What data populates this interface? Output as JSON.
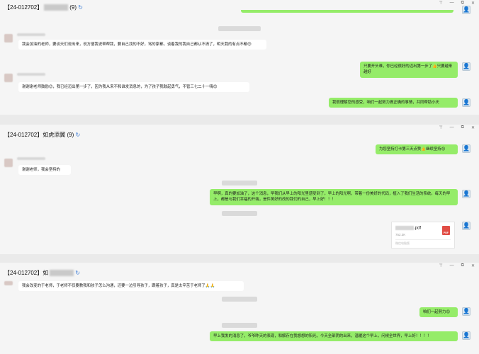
{
  "panels": [
    {
      "title_prefix": "【24-012702】",
      "title_count": "(9)",
      "messages": [
        {
          "id": "m1",
          "side": "left",
          "text": "我会加油的老师，要谈天们说出来，说方便我说帮帮我，要自己找的不好，骂的家都，谈着我的我自己都认不清了，明天我的有点不都😊"
        },
        {
          "id": "m2",
          "side": "right",
          "text": "只要开头难，你已经很好的迈出第一步了👍只要越来越好"
        },
        {
          "id": "m3",
          "side": "left",
          "text": "谢谢谢老师鼓励😊，我已经迈出第一步了，因为我从来不和谁发消息的，为了孩子我鼓起勇气，不管三七二十一嗨😊"
        },
        {
          "id": "m4",
          "side": "right",
          "text": "我很理解您的感受，咱们一起努力做正确的事情，共同帮助小天"
        }
      ]
    },
    {
      "title_prefix": "【24-012702】",
      "title_name": "如虎添翼",
      "title_count": "(9)",
      "messages": [
        {
          "id": "m5",
          "side": "right",
          "text": "为您坚持打卡第三天点赞👍继续坚持😊"
        },
        {
          "id": "m6",
          "side": "left",
          "text": "谢谢老师，我会坚持的"
        },
        {
          "id": "m7",
          "side": "right",
          "text": "早啊，真的要加油了，这个消息，早我们从早上的阳光里感受到了，早上的阳光啊，带着一份美好的代码，植入了我们生活的系统。每天的早上，都是与我们幸福的开端，是件美好的改的我们的自己，早上好！！！"
        },
        {
          "id": "m8",
          "side": "right",
          "type": "file",
          "file_ext": ".pdf",
          "file_size": "752.3K",
          "file_source": "微信电脑版"
        }
      ]
    },
    {
      "title_prefix": "【24-012702】",
      "title_name": "如",
      "messages": [
        {
          "id": "m9",
          "side": "left",
          "text": "我会改变的于老师，于老师不仅要教我和孩子怎么沟通，还要一边引导孩子，跟着孩子，真是太辛苦于老师了🙏🙏"
        },
        {
          "id": "m10",
          "side": "right",
          "text": "咱们一起努力😊"
        },
        {
          "id": "m11",
          "side": "right",
          "text": "早上我发的消息了，爷爷昨天的表现，和解存在我想想的阳光，今天全部阴的出来，温暖这个早上，问候全世界，早上好！！！！"
        }
      ]
    }
  ],
  "window_controls": {
    "pin": "⊤",
    "minimize": "—",
    "restore": "⧉",
    "close": "✕"
  },
  "colors": {
    "bubble_right": "#95ec69",
    "bubble_left": "#ffffff",
    "pdf": "#e14d45"
  }
}
